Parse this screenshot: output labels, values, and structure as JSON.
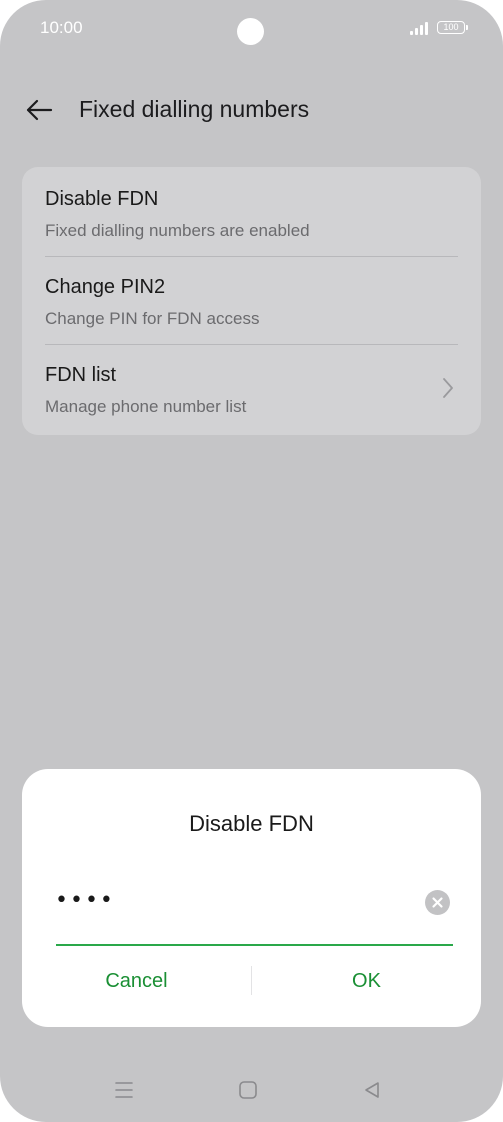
{
  "status_bar": {
    "time": "10:00",
    "battery": "100",
    "signal_icon": "signal-bars-icon",
    "battery_icon": "battery-icon"
  },
  "header": {
    "title": "Fixed dialling numbers",
    "back_icon": "arrow-left-icon"
  },
  "settings": {
    "items": [
      {
        "title": "Disable FDN",
        "subtitle": "Fixed dialling numbers are enabled"
      },
      {
        "title": "Change PIN2",
        "subtitle": "Change PIN for FDN access"
      },
      {
        "title": "FDN list",
        "subtitle": "Manage phone number list",
        "trailing_icon": "chevron-right-icon"
      }
    ]
  },
  "dialog": {
    "title": "Disable FDN",
    "pin_value": "••••",
    "clear_icon": "clear-circle-icon",
    "cancel_label": "Cancel",
    "ok_label": "OK"
  },
  "nav_bar": {
    "icons": [
      "menu-lines-icon",
      "home-square-icon",
      "back-triangle-icon"
    ]
  },
  "colors": {
    "background": "#c5c5c7",
    "card": "#d2d2d4",
    "accent": "#1a8f34",
    "input_underline": "#2aa84a",
    "dialog": "#ffffff"
  }
}
